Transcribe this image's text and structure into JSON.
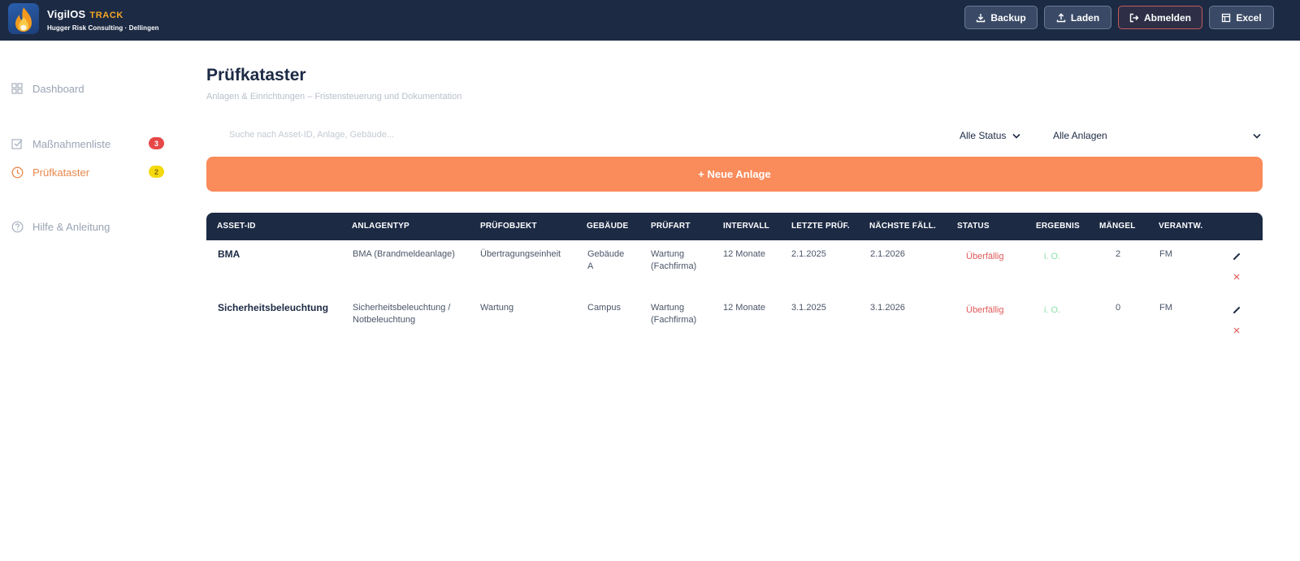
{
  "app": {
    "name": "VigilOS",
    "product": "TRACK",
    "company": "Hugger Risk Consulting · Dellingen"
  },
  "toolbar": {
    "backup_label": "Backup",
    "load_label": "Laden",
    "logout_label": "Abmelden",
    "excel_label": "Excel"
  },
  "sidebar": {
    "items": [
      {
        "label": "Dashboard",
        "icon": "grid-icon"
      },
      {
        "label": "Maßnahmenliste",
        "icon": "checklist-icon",
        "badge": "3"
      },
      {
        "label": "Prüfkataster",
        "icon": "clock-icon",
        "badge": "2",
        "active": true
      },
      {
        "label": "Hilfe & Anleitung",
        "icon": "help-icon"
      }
    ]
  },
  "page": {
    "title": "Prüfkataster",
    "subtitle": "Anlagen & Einrichtungen – Fristensteuerung und Dokumentation"
  },
  "filters": {
    "search_placeholder": "Suche nach Asset-ID, Anlage, Gebäude...",
    "status_value": "Alle Status",
    "type_value": "Alle Anlagen"
  },
  "add_button_label": "+ Neue Anlage",
  "table": {
    "columns": [
      "ASSET-ID",
      "ANLAGENTYP",
      "PRÜFOBJEKT",
      "GEBÄUDE",
      "PRÜFART",
      "INTERVALL",
      "LETZTE PRÜF.",
      "NÄCHSTE FÄLL.",
      "STATUS",
      "ERGEBNIS",
      "MÄNGEL",
      "VERANTW."
    ],
    "rows": [
      {
        "asset_id": "BMA",
        "type": "BMA (Brandmeldeanlage)",
        "object": "Übertragungseinheit",
        "building": "Gebäude A",
        "check_type": "Wartung (Fachfirma)",
        "interval": "12 Monate",
        "last": "2.1.2025",
        "next": "2.1.2026",
        "status": "Überfällig",
        "result": "i. O.",
        "defects": "2",
        "responsible": "FM"
      },
      {
        "asset_id": "Sicherheitsbeleuchtung",
        "type": "Sicherheitsbeleuchtung / Notbeleuchtung",
        "object": "Wartung",
        "building": "Campus",
        "check_type": "Wartung (Fachfirma)",
        "interval": "12 Monate",
        "last": "3.1.2025",
        "next": "3.1.2026",
        "status": "Überfällig",
        "result": "i. O.",
        "defects": "0",
        "responsible": "FM"
      }
    ]
  },
  "colors": {
    "header_bg": "#1c2a44",
    "accent_orange": "#fa8b5a",
    "status_overdue": "#e05a5a",
    "result_ok": "#8be0a8",
    "badge_red": "#e64848",
    "badge_yellow": "#f4d90f"
  }
}
